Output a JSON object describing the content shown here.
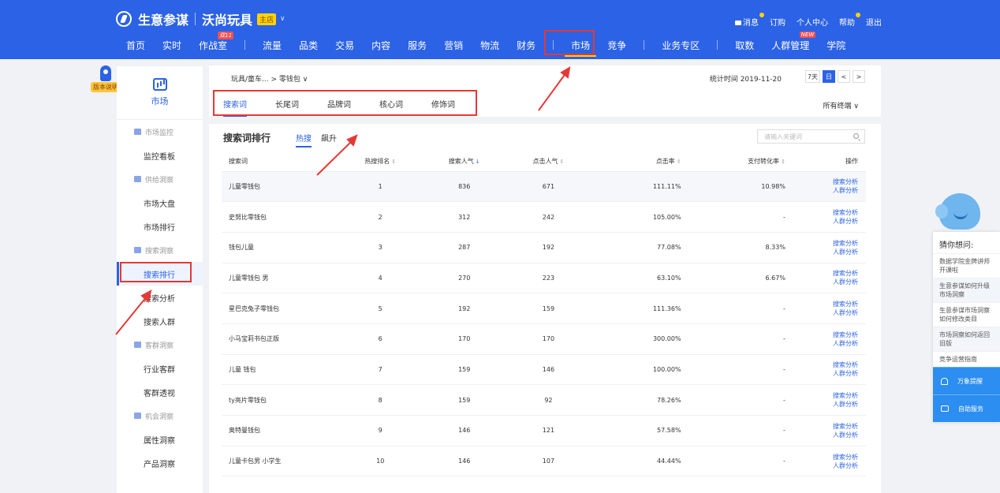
{
  "header": {
    "brand": "生意参谋",
    "shop_name": "沃尚玩具",
    "shop_badge": "主店",
    "top_links": [
      "消息",
      "订购",
      "个人中心",
      "帮助"
    ],
    "logout": "退出",
    "nav": [
      "首页",
      "实时",
      "作战室",
      "流量",
      "品类",
      "交易",
      "内容",
      "服务",
      "营销",
      "物流",
      "财务",
      "市场",
      "竞争",
      "业务专区",
      "取数",
      "人群管理",
      "学院"
    ],
    "nav_active": "市场",
    "tag_war_room": "双11",
    "tag_crowd": "NEW"
  },
  "version_label": "版本说明",
  "sidebar": {
    "head_label": "市场",
    "groups": [
      {
        "label": "市场监控",
        "items": [
          "监控看板"
        ]
      },
      {
        "label": "供给洞察",
        "items": [
          "市场大盘",
          "市场排行"
        ]
      },
      {
        "label": "搜索洞察",
        "items": [
          "搜索排行",
          "搜索分析",
          "搜索人群"
        ]
      },
      {
        "label": "客群洞察",
        "items": [
          "行业客群",
          "客群透视"
        ]
      },
      {
        "label": "机会洞察",
        "items": [
          "属性洞察",
          "产品洞察"
        ]
      }
    ],
    "active": "搜索排行"
  },
  "filter": {
    "breadcrumb": "玩具/童车... > 零钱包",
    "stat_time": "统计时间 2019-11-20",
    "date_buttons": [
      "7天",
      "日",
      "<",
      ">"
    ],
    "subtabs": [
      "搜索词",
      "长尾词",
      "品牌词",
      "核心词",
      "修饰词"
    ],
    "terminal": "所有终端"
  },
  "ranking": {
    "title": "搜索词排行",
    "tabs": [
      "热搜",
      "飙升"
    ],
    "search_placeholder": "请输入关键词",
    "columns": [
      "搜索词",
      "热搜排名",
      "搜索人气",
      "点击人气",
      "点击率",
      "支付转化率",
      "操作"
    ],
    "op_links": [
      "搜索分析",
      "人群分析"
    ],
    "rows": [
      {
        "kw": "儿童零钱包",
        "rank": "1",
        "search": "836",
        "click": "671",
        "ctr": "111.11%",
        "pay": "10.98%"
      },
      {
        "kw": "史努比零钱包",
        "rank": "2",
        "search": "312",
        "click": "242",
        "ctr": "105.00%",
        "pay": "-"
      },
      {
        "kw": "钱包儿童",
        "rank": "3",
        "search": "287",
        "click": "192",
        "ctr": "77.08%",
        "pay": "8.33%"
      },
      {
        "kw": "儿童零钱包 男",
        "rank": "4",
        "search": "270",
        "click": "223",
        "ctr": "63.10%",
        "pay": "6.67%"
      },
      {
        "kw": "星巴克兔子零钱包",
        "rank": "5",
        "search": "192",
        "click": "159",
        "ctr": "111.36%",
        "pay": "-"
      },
      {
        "kw": "小马宝莉书包正版",
        "rank": "6",
        "search": "170",
        "click": "170",
        "ctr": "300.00%",
        "pay": "-"
      },
      {
        "kw": "儿童 钱包",
        "rank": "7",
        "search": "159",
        "click": "146",
        "ctr": "100.00%",
        "pay": "-"
      },
      {
        "kw": "ty亮片零钱包",
        "rank": "8",
        "search": "159",
        "click": "92",
        "ctr": "78.26%",
        "pay": "-"
      },
      {
        "kw": "奥特曼钱包",
        "rank": "9",
        "search": "146",
        "click": "121",
        "ctr": "57.58%",
        "pay": "-"
      },
      {
        "kw": "儿童卡包男 小学生",
        "rank": "10",
        "search": "146",
        "click": "107",
        "ctr": "44.44%",
        "pay": "-"
      }
    ]
  },
  "assistant": {
    "title": "猜你想问:",
    "items": [
      "数据学院金牌讲师开课啦",
      "生意参谋如何升级市场洞察",
      "生意参谋市场洞察如何修改类目",
      "市场洞察如何返回旧版",
      "竞争运营指南"
    ],
    "buttons": [
      "万象提醒",
      "自助服务"
    ]
  },
  "colors": {
    "primary": "#2b62e6",
    "annotation": "#e53935",
    "highlight": "#ffd200"
  }
}
